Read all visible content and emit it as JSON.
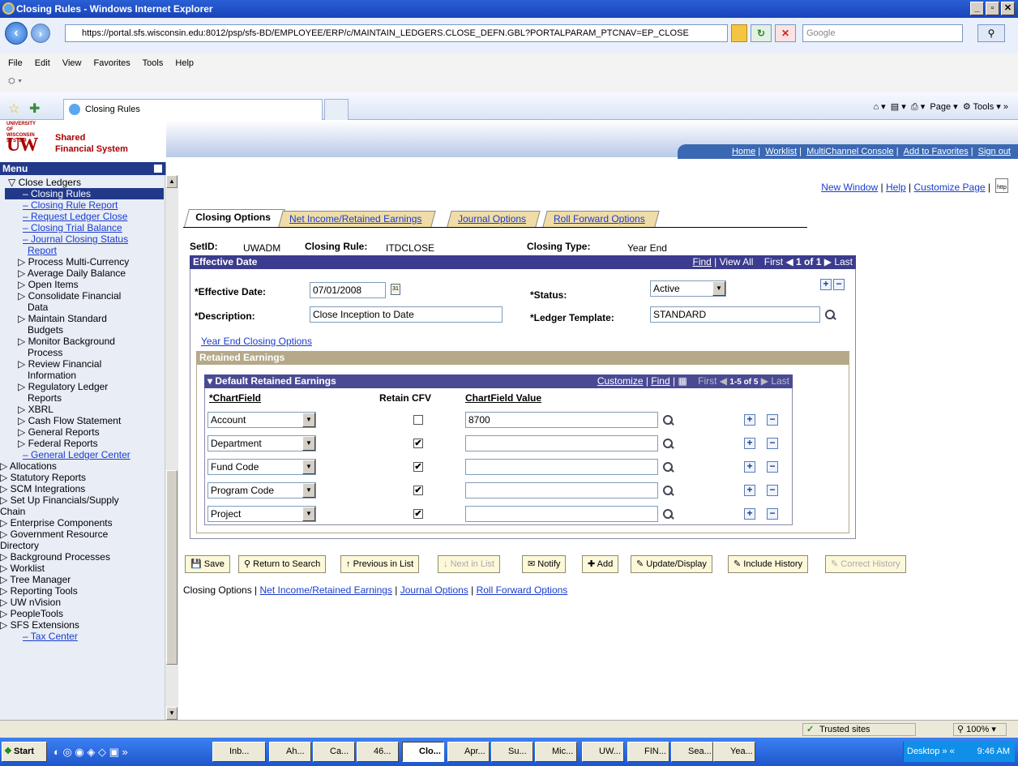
{
  "window": {
    "title": "Closing Rules - Windows Internet Explorer"
  },
  "browser": {
    "url": "https://portal.sfs.wisconsin.edu:8012/psp/sfs-BD/EMPLOYEE/ERP/c/MAINTAIN_LEDGERS.CLOSE_DEFN.GBL?PORTALPARAM_PTCNAV=EP_CLOSE",
    "search_placeholder": "Google",
    "menu": [
      "File",
      "Edit",
      "View",
      "Favorites",
      "Tools",
      "Help"
    ],
    "tab_label": "Closing Rules",
    "tools": {
      "page": "Page",
      "tools": "Tools"
    }
  },
  "header": {
    "logo_line1": "UNIVERSITY OF WISCONSIN SYSTEM",
    "logo_line2": "Shared",
    "logo_line3": "Financial System",
    "links": [
      "Home",
      "Worklist",
      "MultiChannel Console",
      "Add to Favorites",
      "Sign out"
    ]
  },
  "sidebar": {
    "title": "Menu",
    "items": [
      "▽ Close Ledgers",
      "– Closing Rules",
      "– Closing Rule Report",
      "– Request Ledger Close",
      "– Closing Trial Balance",
      "– Journal Closing Status",
      "Report",
      "▷ Process Multi-Currency",
      "▷ Average Daily Balance",
      "▷ Open Items",
      "▷ Consolidate Financial",
      "Data",
      "▷ Maintain Standard",
      "Budgets",
      "▷ Monitor Background",
      "Process",
      "▷ Review Financial",
      "Information",
      "▷ Regulatory Ledger",
      "Reports",
      "▷ XBRL",
      "▷ Cash Flow Statement",
      "▷ General Reports",
      "▷ Federal Reports",
      "– General Ledger Center",
      "▷ Allocations",
      "▷ Statutory Reports",
      "▷ SCM Integrations",
      "▷ Set Up Financials/Supply",
      "Chain",
      "▷ Enterprise Components",
      "▷ Government Resource",
      "Directory",
      "▷ Background Processes",
      "▷ Worklist",
      "▷ Tree Manager",
      "▷ Reporting Tools",
      "▷ UW nVision",
      "▷ PeopleTools",
      "▷ SFS Extensions",
      "– Tax Center"
    ]
  },
  "toplinks": {
    "new_window": "New Window",
    "help": "Help",
    "customize": "Customize Page"
  },
  "tabs": [
    "Closing Options",
    "Net Income/Retained Earnings",
    "Journal Options",
    "Roll Forward Options"
  ],
  "info": {
    "setid_label": "SetID:",
    "setid": "UWADM",
    "rule_label": "Closing Rule:",
    "rule": "ITDCLOSE",
    "type_label": "Closing Type:",
    "type": "Year End"
  },
  "effective": {
    "bar_title": "Effective Date",
    "find": "Find",
    "view_all": "View All",
    "first": "First",
    "range": "1 of 1",
    "last": "Last",
    "date_label": "*Effective Date:",
    "date": "07/01/2008",
    "desc_label": "*Description:",
    "desc": "Close Inception to Date",
    "status_label": "*Status:",
    "status": "Active",
    "template_label": "*Ledger Template:",
    "template": "STANDARD"
  },
  "year_end_link": "Year End Closing Options",
  "retained": {
    "section_title": "Retained Earnings",
    "grid_title": "Default Retained Earnings",
    "customize": "Customize",
    "find": "Find",
    "first": "First",
    "range": "1-5 of 5",
    "last": "Last",
    "col_chartfield": "*ChartField",
    "col_retain": "Retain CFV",
    "col_value": "ChartField Value",
    "rows": [
      {
        "chartfield": "Account",
        "retain": "",
        "value": "8700"
      },
      {
        "chartfield": "Department",
        "retain": "✔",
        "value": ""
      },
      {
        "chartfield": "Fund Code",
        "retain": "✔",
        "value": ""
      },
      {
        "chartfield": "Program Code",
        "retain": "✔",
        "value": ""
      },
      {
        "chartfield": "Project",
        "retain": "✔",
        "value": ""
      }
    ]
  },
  "buttons": [
    "Save",
    "Return to Search",
    "Previous in List",
    "Next in List",
    "Notify",
    "Add",
    "Update/Display",
    "Include History",
    "Correct History"
  ],
  "bottom_links": [
    "Closing Options",
    "Net Income/Retained Earnings",
    "Journal Options",
    "Roll Forward Options"
  ],
  "status": {
    "zone": "Trusted sites",
    "zoom": "100%"
  },
  "taskbar": {
    "start": "Start",
    "tasks": [
      "Inb...",
      "Ah...",
      "Ca...",
      "46...",
      "Clo...",
      "Apr...",
      "Su...",
      "Mic...",
      "UW...",
      "FIN...",
      "Sea...",
      "Yea..."
    ],
    "desktop": "Desktop",
    "time": "9:46 AM"
  }
}
